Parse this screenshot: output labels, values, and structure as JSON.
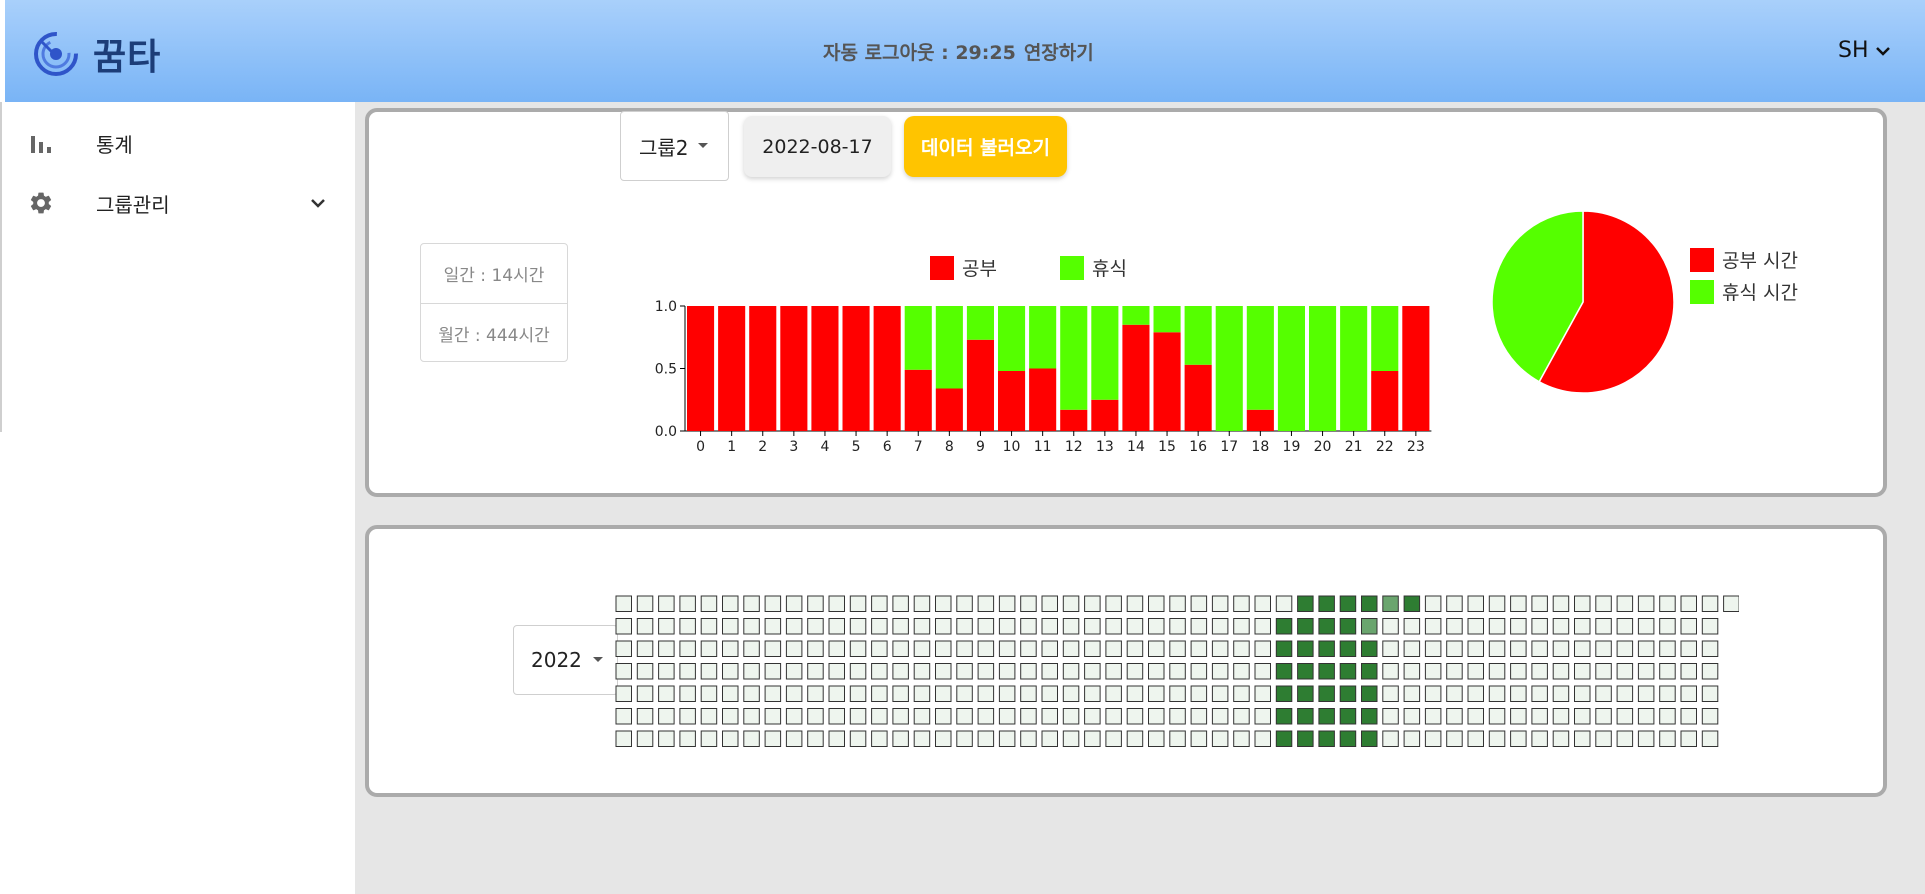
{
  "header": {
    "app_title": "꿈타",
    "logout_label": "자동 로그아웃 : 29:25",
    "extend_label": "연장하기",
    "user_initials": "SH"
  },
  "sidebar": {
    "items": [
      {
        "label": "통계",
        "icon": "bar-chart-icon"
      },
      {
        "label": "그룹관리",
        "icon": "gear-icon",
        "expandable": true
      }
    ]
  },
  "controls": {
    "group_value": "그룹2",
    "date_value": "2022-08-17",
    "load_label": "데이터 불러오기",
    "year_value": "2022"
  },
  "summary": {
    "daily": "일간 : 14시간",
    "monthly": "월간 : 444시간"
  },
  "colors": {
    "study": "#ff0000",
    "rest": "#55ff00",
    "accent": "#ffc400",
    "grass_on": "#2e7d32",
    "grass_light": "#6aa56e",
    "grass_off": "#eef5ee"
  },
  "chart_data": [
    {
      "type": "bar",
      "stacked": true,
      "categories": [
        "0",
        "1",
        "2",
        "3",
        "4",
        "5",
        "6",
        "7",
        "8",
        "9",
        "10",
        "11",
        "12",
        "13",
        "14",
        "15",
        "16",
        "17",
        "18",
        "19",
        "20",
        "21",
        "22",
        "23"
      ],
      "series": [
        {
          "name": "공부",
          "values": [
            1,
            1,
            1,
            1,
            1,
            1,
            1,
            0.49,
            0.34,
            0.73,
            0.48,
            0.5,
            0.17,
            0.25,
            0.85,
            0.79,
            0.53,
            0,
            0.17,
            0,
            0,
            0,
            0.48,
            1
          ]
        },
        {
          "name": "휴식",
          "values": [
            0,
            0,
            0,
            0,
            0,
            0,
            0,
            0.51,
            0.66,
            0.27,
            0.52,
            0.5,
            0.83,
            0.75,
            0.15,
            0.21,
            0.47,
            1,
            0.83,
            1,
            1,
            1,
            0.52,
            0
          ]
        }
      ],
      "yticks": [
        "1.0",
        "0.5",
        "0.0"
      ],
      "ylim": [
        0,
        1
      ],
      "legend_position": "top"
    },
    {
      "type": "pie",
      "labels": [
        "공부 시간",
        "휴식 시간"
      ],
      "values": [
        0.58,
        0.42
      ],
      "legend_position": "right"
    }
  ],
  "grass": {
    "rows": 7,
    "cols": 53,
    "active_cols": [
      31,
      32,
      33,
      34,
      35,
      36
    ],
    "light": [
      [
        0,
        36
      ],
      [
        1,
        35
      ]
    ],
    "first_row_extra_start": true
  }
}
